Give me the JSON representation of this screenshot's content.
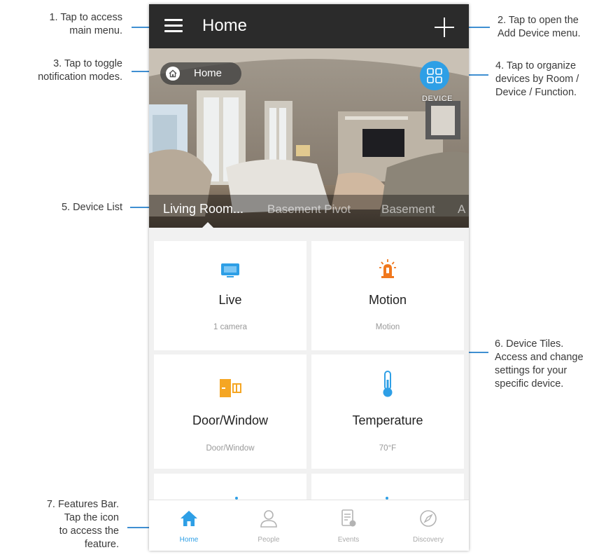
{
  "annotations": {
    "menu": [
      "1. Tap to access",
      "main menu."
    ],
    "add_device": [
      "2. Tap to open the",
      "Add Device menu."
    ],
    "notification": [
      "3. Tap to toggle",
      "notification modes."
    ],
    "organize": [
      "4. Tap to organize",
      "devices by Room /",
      "Device / Function."
    ],
    "device_list": [
      "5. Device List"
    ],
    "device_tiles": [
      "6. Device Tiles.",
      "Access and change",
      "settings for your",
      "specific device."
    ],
    "features_bar": [
      "7. Features Bar.",
      "Tap the icon",
      "to access the",
      "feature."
    ]
  },
  "appbar": {
    "title": "Home"
  },
  "hero": {
    "mode_label": "Home",
    "device_toggle_label": "DEVICE",
    "device_tabs": [
      "Living Room...",
      "Basement Pivot",
      "Basement",
      "A"
    ]
  },
  "tiles": [
    {
      "name": "Live",
      "sub": "1 camera",
      "icon": "tv-icon",
      "color": "#2e9fe6"
    },
    {
      "name": "Motion",
      "sub": "Motion",
      "icon": "siren-icon",
      "color": "#f0781e"
    },
    {
      "name": "Door/Window",
      "sub": "Door/Window",
      "icon": "door-sensor-icon",
      "color": "#f5a623"
    },
    {
      "name": "Temperature",
      "sub": "70°F",
      "icon": "thermometer-icon",
      "color": "#2e9fe6"
    }
  ],
  "features": [
    {
      "label": "Home",
      "icon": "home-icon",
      "active": true
    },
    {
      "label": "People",
      "icon": "person-icon",
      "active": false
    },
    {
      "label": "Events",
      "icon": "events-icon",
      "active": false
    },
    {
      "label": "Discovery",
      "icon": "compass-icon",
      "active": false
    }
  ],
  "colors": {
    "accent": "#2e9fe6",
    "appbar": "#2b2b2b",
    "leader": "#3f8fd2"
  }
}
